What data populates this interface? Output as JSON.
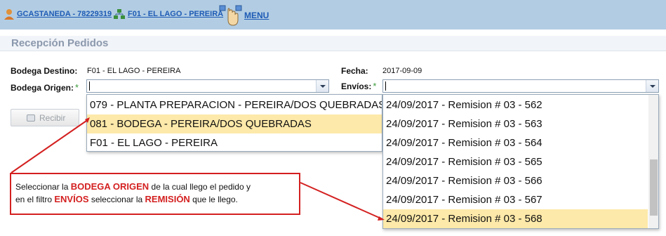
{
  "header": {
    "user_link": "GCASTANEDA - 78229319",
    "store_link": "F01 - EL LAGO - PEREIRA",
    "menu_label": "MENU"
  },
  "page": {
    "title": "Recepción Pedidos"
  },
  "form": {
    "destino_label": "Bodega Destino:",
    "destino_value": "F01 - EL LAGO - PEREIRA",
    "fecha_label": "Fecha:",
    "fecha_value": "2017-09-09",
    "origen_label": "Bodega Origen:",
    "envios_label": "Envíos:",
    "required_mark": "*",
    "recibir_label": "Recibir"
  },
  "origen_options": [
    {
      "label": "079 - PLANTA PREPARACION - PEREIRA/DOS QUEBRADAS",
      "selected": false
    },
    {
      "label": "081 - BODEGA - PEREIRA/DOS QUEBRADAS",
      "selected": true
    },
    {
      "label": "F01 - EL LAGO - PEREIRA",
      "selected": false
    }
  ],
  "envios_options": [
    {
      "label": "24/09/2017 - Remision # 03 - 562",
      "selected": false
    },
    {
      "label": "24/09/2017 - Remision # 03 - 563",
      "selected": false
    },
    {
      "label": "24/09/2017 - Remision # 03 - 564",
      "selected": false
    },
    {
      "label": "24/09/2017 - Remision # 03 - 565",
      "selected": false
    },
    {
      "label": "24/09/2017 - Remision # 03 - 566",
      "selected": false
    },
    {
      "label": "24/09/2017 - Remision # 03 - 567",
      "selected": false
    },
    {
      "label": "24/09/2017 - Remision # 03 - 568",
      "selected": true
    }
  ],
  "annotation": {
    "line1_a": "Seleccionar la ",
    "line1_b": "BODEGA ORIGEN",
    "line1_c": " de la cual llego el pedido y",
    "line2_a": "en el filtro ",
    "line2_b": "ENVÍOS",
    "line2_c": " seleccionar la ",
    "line2_d": "REMISIÓN",
    "line2_e": " que le llego."
  },
  "colors": {
    "header_bg": "#b2cde3",
    "link": "#1e5bb5",
    "highlight": "#fde9a9",
    "annotation_red": "#d42020",
    "required_green": "#3b9a3b"
  }
}
